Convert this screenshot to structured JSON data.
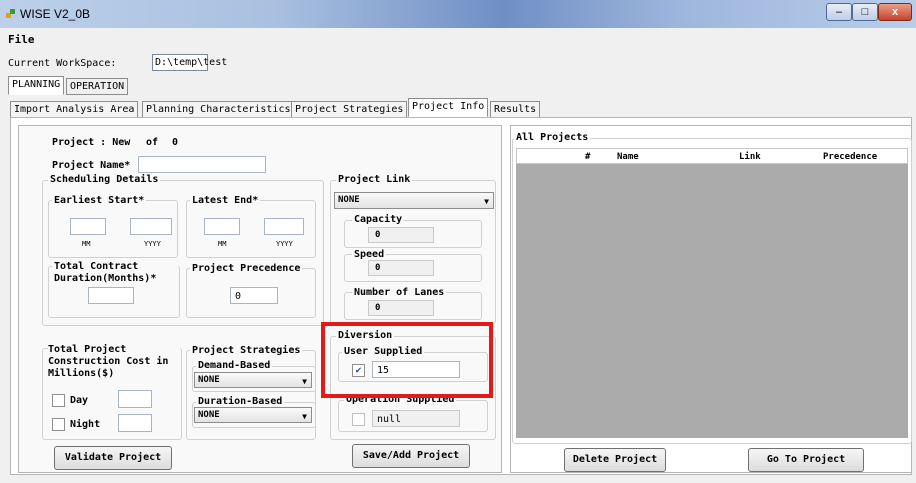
{
  "window": {
    "title": "WISE V2_0B",
    "minimize": "–",
    "maximize": "□",
    "close": "x"
  },
  "menu": {
    "file": "File"
  },
  "workspace": {
    "label": "Current WorkSpace:",
    "value": "D:\\temp\\test"
  },
  "main_tabs": [
    "PLANNING",
    "OPERATION"
  ],
  "sub_tabs": [
    "Import Analysis Area",
    "Planning Characteristics",
    "Project Strategies",
    "Project Info",
    "Results"
  ],
  "project": {
    "header_label": "Project : New",
    "of_label": "of",
    "count": "0",
    "name_label": "Project Name*",
    "name_value": ""
  },
  "scheduling": {
    "title": "Scheduling Details",
    "earliest_start": "Earliest Start*",
    "latest_end": "Latest End*",
    "mm": "MM",
    "yyyy": "YYYY",
    "duration_label": "Total Contract Duration(Months)*",
    "duration_value": "",
    "precedence_label": "Project Precedence",
    "precedence_value": "0"
  },
  "project_link": {
    "title": "Project Link",
    "selected": "NONE",
    "capacity_label": "Capacity",
    "capacity_value": "0",
    "speed_label": "Speed",
    "speed_value": "0",
    "lanes_label": "Number of Lanes",
    "lanes_value": "0"
  },
  "diversion": {
    "title": "Diversion",
    "user_supplied_label": "User Supplied",
    "user_supplied_checked": true,
    "user_supplied_value": "15",
    "operation_supplied_label": "Operation Supplied",
    "operation_supplied_checked": false,
    "operation_supplied_value": "null"
  },
  "cost": {
    "title": "Total Project Construction Cost in Millions($)",
    "day_label": "Day",
    "night_label": "Night"
  },
  "strategies": {
    "title": "Project Strategies",
    "demand_label": "Demand-Based",
    "demand_value": "NONE",
    "duration_label": "Duration-Based",
    "duration_value": "NONE"
  },
  "buttons": {
    "validate": "Validate Project",
    "save_add": "Save/Add Project",
    "delete": "Delete Project",
    "goto": "Go To Project"
  },
  "all_projects": {
    "title": "All Projects",
    "columns": [
      "#",
      "Name",
      "Link",
      "Precedence"
    ]
  },
  "colors": {
    "highlight": "#e11a1a",
    "grid_bg": "#ababab"
  }
}
